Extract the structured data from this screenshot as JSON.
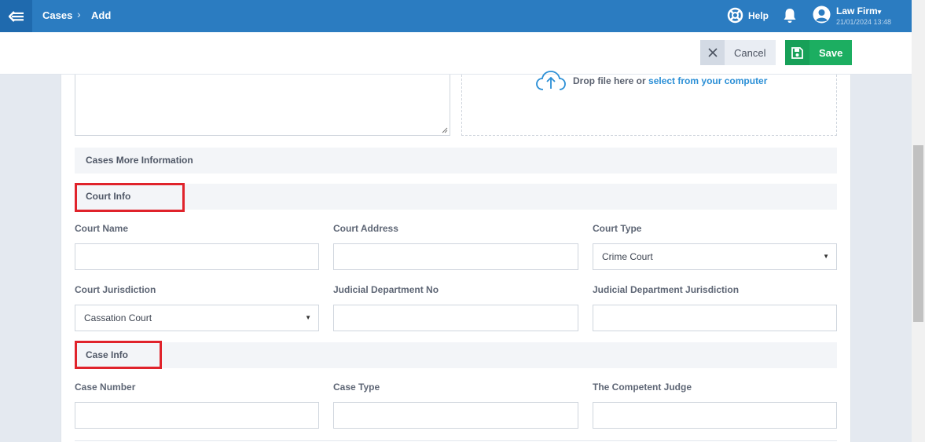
{
  "nav": {
    "breadcrumb_1": "Cases",
    "breadcrumb_sep": "›",
    "breadcrumb_2": "Add",
    "help": "Help",
    "user_name": "Law Firm",
    "user_caret": "▾",
    "timestamp": "21/01/2024 13:48"
  },
  "actions": {
    "cancel": "Cancel",
    "save": "Save"
  },
  "upload": {
    "text": "Drop file here or ",
    "link": "select from your computer"
  },
  "sections": {
    "more_info": "Cases More Information",
    "court_info": "Court Info",
    "case_info": "Case Info"
  },
  "fields": {
    "court_name": "Court Name",
    "court_address": "Court Address",
    "court_type": "Court Type",
    "court_type_value": "Crime Court",
    "court_jurisdiction": "Court Jurisdiction",
    "court_jurisdiction_value": "Cassation Court",
    "judicial_dept_no": "Judicial Department No",
    "judicial_dept_jurisdiction": "Judicial Department Jurisdiction",
    "case_number": "Case Number",
    "case_type": "Case Type",
    "competent_judge": "The Competent Judge"
  },
  "colors": {
    "nav": "#2b7cc1",
    "save": "#1cae61",
    "highlight": "#e0232b",
    "link": "#2b8fd6"
  }
}
